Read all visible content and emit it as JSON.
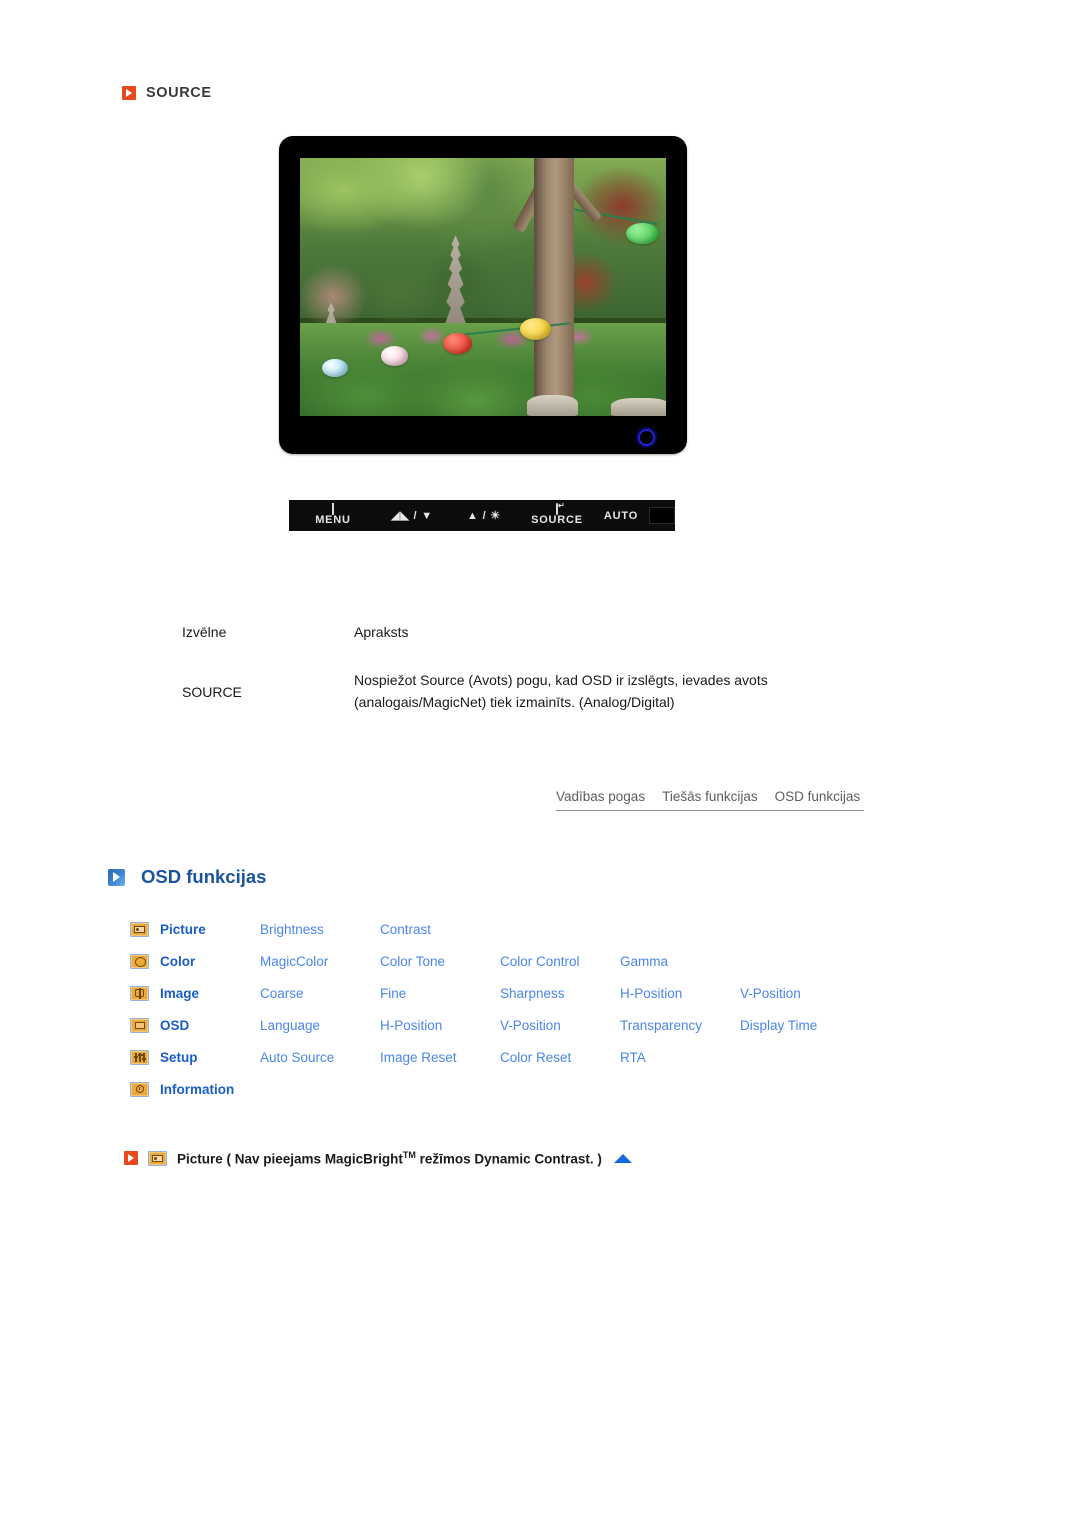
{
  "source_section": {
    "bullet_icon": "orange-play-bullet-icon",
    "title": "SOURCE"
  },
  "monitor": {
    "screen_content_description": "Garden photo with stone pagodas, trees and colored paper lanterns",
    "power_led_color": "#2020ff",
    "buttons": [
      {
        "name": "menu-button",
        "icon": "menu-grid-icon",
        "label": "MENU"
      },
      {
        "name": "down-button",
        "icon": "contrast-down-icon",
        "label": "◢◣ / ▼"
      },
      {
        "name": "up-button",
        "icon": "brightness-up-icon",
        "label": "▲ / ☀"
      },
      {
        "name": "source-button",
        "icon": "enter-return-icon",
        "label": "SOURCE"
      },
      {
        "name": "auto-button",
        "icon": "",
        "label": "AUTO"
      },
      {
        "name": "power-button",
        "icon": "blank-key-icon",
        "label": ""
      }
    ]
  },
  "description_table": {
    "headers": {
      "menu": "Izvēlne",
      "description": "Apraksts"
    },
    "rows": [
      {
        "menu": "SOURCE",
        "description": "Nospiežot Source (Avots) pogu, kad OSD ir izslēgts, ievades avots (analogais/MagicNet) tiek izmainīts. (Analog/Digital)"
      }
    ]
  },
  "tab_bar": {
    "tabs": [
      {
        "label": "Vadības pogas"
      },
      {
        "label": "Tiešās funkcijas"
      },
      {
        "label": "OSD funkcijas"
      }
    ]
  },
  "osd_heading": {
    "bullet_icon": "blue-play-bullet-icon",
    "title": "OSD funkcijas",
    "color": "#19549e"
  },
  "osd_matrix": {
    "rows": [
      {
        "icon": "picture-icon",
        "category": "Picture",
        "items": [
          "Brightness",
          "Contrast"
        ]
      },
      {
        "icon": "color-icon",
        "category": "Color",
        "items": [
          "MagicColor",
          "Color Tone",
          "Color Control",
          "Gamma"
        ]
      },
      {
        "icon": "image-icon",
        "category": "Image",
        "items": [
          "Coarse",
          "Fine",
          "Sharpness",
          "H-Position",
          "V-Position"
        ]
      },
      {
        "icon": "osd-icon",
        "category": "OSD",
        "items": [
          "Language",
          "H-Position",
          "V-Position",
          "Transparency",
          "Display Time"
        ]
      },
      {
        "icon": "setup-icon",
        "category": "Setup",
        "items": [
          "Auto Source",
          "Image Reset",
          "Color Reset",
          "RTA"
        ]
      },
      {
        "icon": "information-icon",
        "category": "Information",
        "items": []
      }
    ],
    "category_color": "#1a5cc8",
    "item_color": "#4a86e8"
  },
  "footer_caption": {
    "bullet_icon": "orange-play-bullet-icon",
    "menu_icon": "picture-icon",
    "text_before": "Picture ( Nav pieejams MagicBright",
    "trademark": "TM",
    "text_after": " režīmos Dynamic Contrast. )",
    "up_arrow_icon": "scroll-to-top-arrow-icon",
    "arrow_color": "#1567e0"
  }
}
